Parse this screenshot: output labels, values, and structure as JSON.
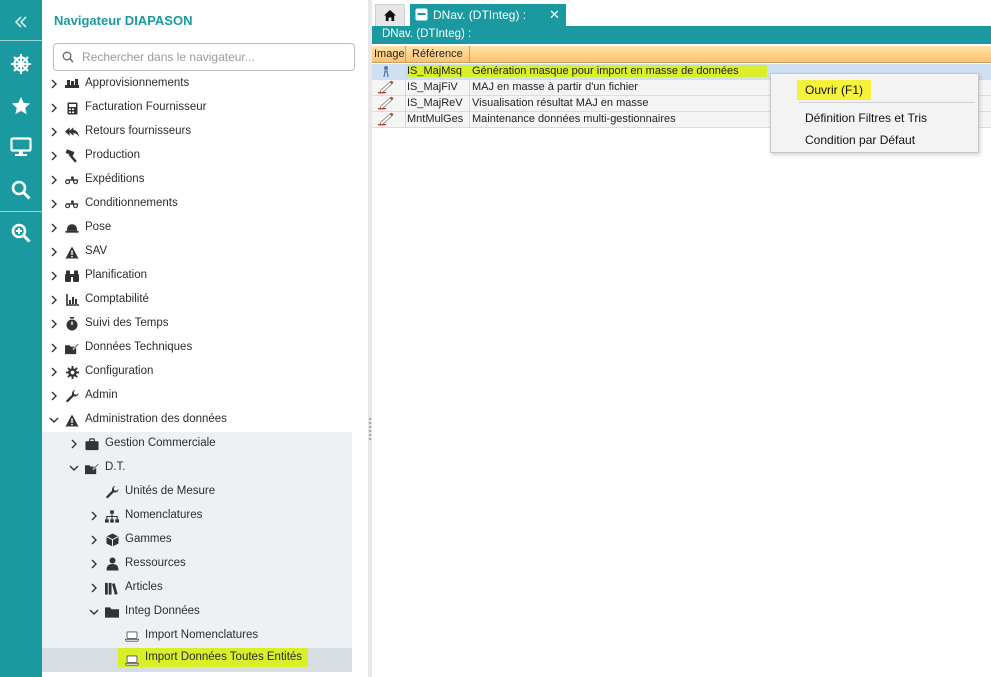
{
  "colors": {
    "accent": "#1a9aa0",
    "highlight": "#d8ef2a",
    "grid_header": "#fcc270",
    "selection": "#cfe0f2"
  },
  "rail": {
    "items": [
      {
        "icon": "collapse-double-chevron-left-icon"
      },
      {
        "icon": "ship-wheel-icon"
      },
      {
        "icon": "star-icon"
      },
      {
        "icon": "monitor-icon"
      },
      {
        "icon": "search-icon"
      },
      {
        "icon": "zoom-plus-icon"
      }
    ]
  },
  "navigator": {
    "title": "Navigateur DIAPASON",
    "search_placeholder": "Rechercher dans le navigateur...",
    "items": [
      {
        "label": "Approvisionnements",
        "icon": "scale-icon"
      },
      {
        "label": "Facturation Fournisseur",
        "icon": "calculator-icon"
      },
      {
        "label": "Retours fournisseurs",
        "icon": "reply-all-icon"
      },
      {
        "label": "Production",
        "icon": "hammer-icon"
      },
      {
        "label": "Expéditions",
        "icon": "truck-icon"
      },
      {
        "label": "Conditionnements",
        "icon": "truck-icon"
      },
      {
        "label": "Pose",
        "icon": "helmet-icon"
      },
      {
        "label": "SAV",
        "icon": "warning-icon"
      },
      {
        "label": "Planification",
        "icon": "binoculars-icon"
      },
      {
        "label": "Comptabilité",
        "icon": "bar-chart-icon"
      },
      {
        "label": "Suivi des Temps",
        "icon": "stopwatch-icon"
      },
      {
        "label": "Données Techniques",
        "icon": "folder-edit-icon"
      },
      {
        "label": "Configuration",
        "icon": "gear-icon"
      },
      {
        "label": "Admin",
        "icon": "wrench-icon"
      },
      {
        "label": "Administration des données",
        "icon": "warning-icon"
      },
      {
        "label": "Gestion Commerciale",
        "icon": "briefcase-icon"
      },
      {
        "label": "D.T.",
        "icon": "folder-edit-icon"
      },
      {
        "label": "Unités de Mesure",
        "icon": "wrench-icon"
      },
      {
        "label": "Nomenclatures",
        "icon": "sitemap-icon"
      },
      {
        "label": "Gammes",
        "icon": "cube-icon"
      },
      {
        "label": "Ressources",
        "icon": "users-icon"
      },
      {
        "label": "Articles",
        "icon": "books-icon"
      },
      {
        "label": "Integ Données",
        "icon": "folder-icon"
      },
      {
        "label": "Import Nomenclatures",
        "icon": "laptop-icon"
      },
      {
        "label": "Import Données Toutes Entités",
        "icon": "laptop-icon"
      }
    ]
  },
  "tabs": {
    "home_icon": "home-icon",
    "active_label": "DNav. (DTInteg) :",
    "close_glyph": "✕"
  },
  "subheader": "DNav. (DTInteg) :",
  "grid": {
    "columns": [
      "Image",
      "Référence"
    ],
    "rows": [
      {
        "ref": "IS_MajMsq",
        "desc": "Génération masque pour import en masse de données",
        "selected": true
      },
      {
        "ref": "IS_MajFiV",
        "desc": "MAJ en masse à partir d'un fichier",
        "selected": false
      },
      {
        "ref": "IS_MajReV",
        "desc": "Visualisation résultat MAJ en masse",
        "selected": false
      },
      {
        "ref": "MntMulGes",
        "desc": "Maintenance données multi-gestionnaires",
        "selected": false
      }
    ]
  },
  "context_menu": {
    "open": "Ouvrir (F1)",
    "filters": "Définition Filtres et Tris",
    "default": "Condition par Défaut"
  }
}
